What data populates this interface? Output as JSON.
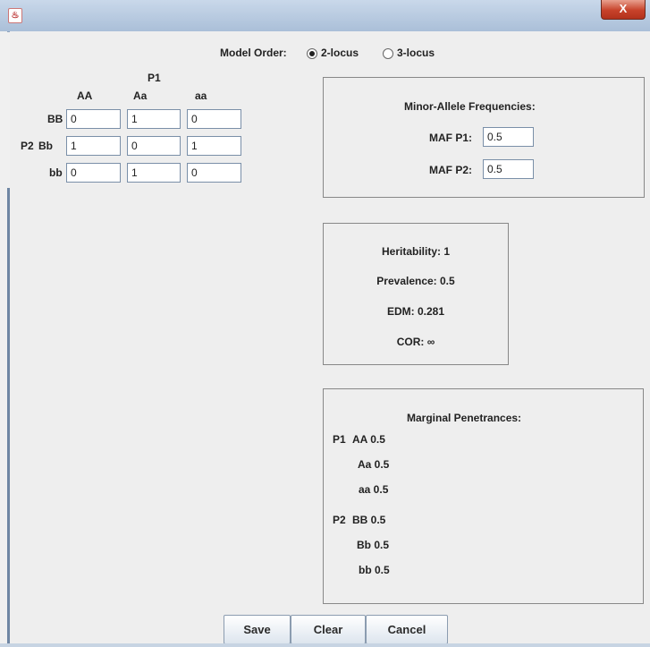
{
  "window": {
    "close_label": "X",
    "app_icon": "java-icon"
  },
  "model_order": {
    "label": "Model Order:",
    "options": [
      "2-locus",
      "3-locus"
    ],
    "selected": "2-locus"
  },
  "grid": {
    "p1_label": "P1",
    "p2_label": "P2",
    "col_headers": [
      "AA",
      "Aa",
      "aa"
    ],
    "row_headers": [
      "BB",
      "Bb",
      "bb"
    ],
    "values": [
      [
        "0",
        "1",
        "0"
      ],
      [
        "1",
        "0",
        "1"
      ],
      [
        "0",
        "1",
        "0"
      ]
    ]
  },
  "maf": {
    "title": "Minor-Allele Frequencies:",
    "p1_label": "MAF P1:",
    "p1_value": "0.5",
    "p2_label": "MAF P2:",
    "p2_value": "0.5"
  },
  "stats": {
    "heritability": "Heritability: 1",
    "prevalence": "Prevalence: 0.5",
    "edm": "EDM: 0.281",
    "cor": "COR: ∞"
  },
  "marginal": {
    "title": "Marginal Penetrances:",
    "p1_label": "P1",
    "p2_label": "P2",
    "p1_rows": [
      "AA 0.5",
      "Aa 0.5",
      "aa 0.5"
    ],
    "p2_rows": [
      "BB 0.5",
      "Bb 0.5",
      "bb 0.5"
    ]
  },
  "buttons": {
    "save": "Save",
    "clear": "Clear",
    "cancel": "Cancel"
  }
}
